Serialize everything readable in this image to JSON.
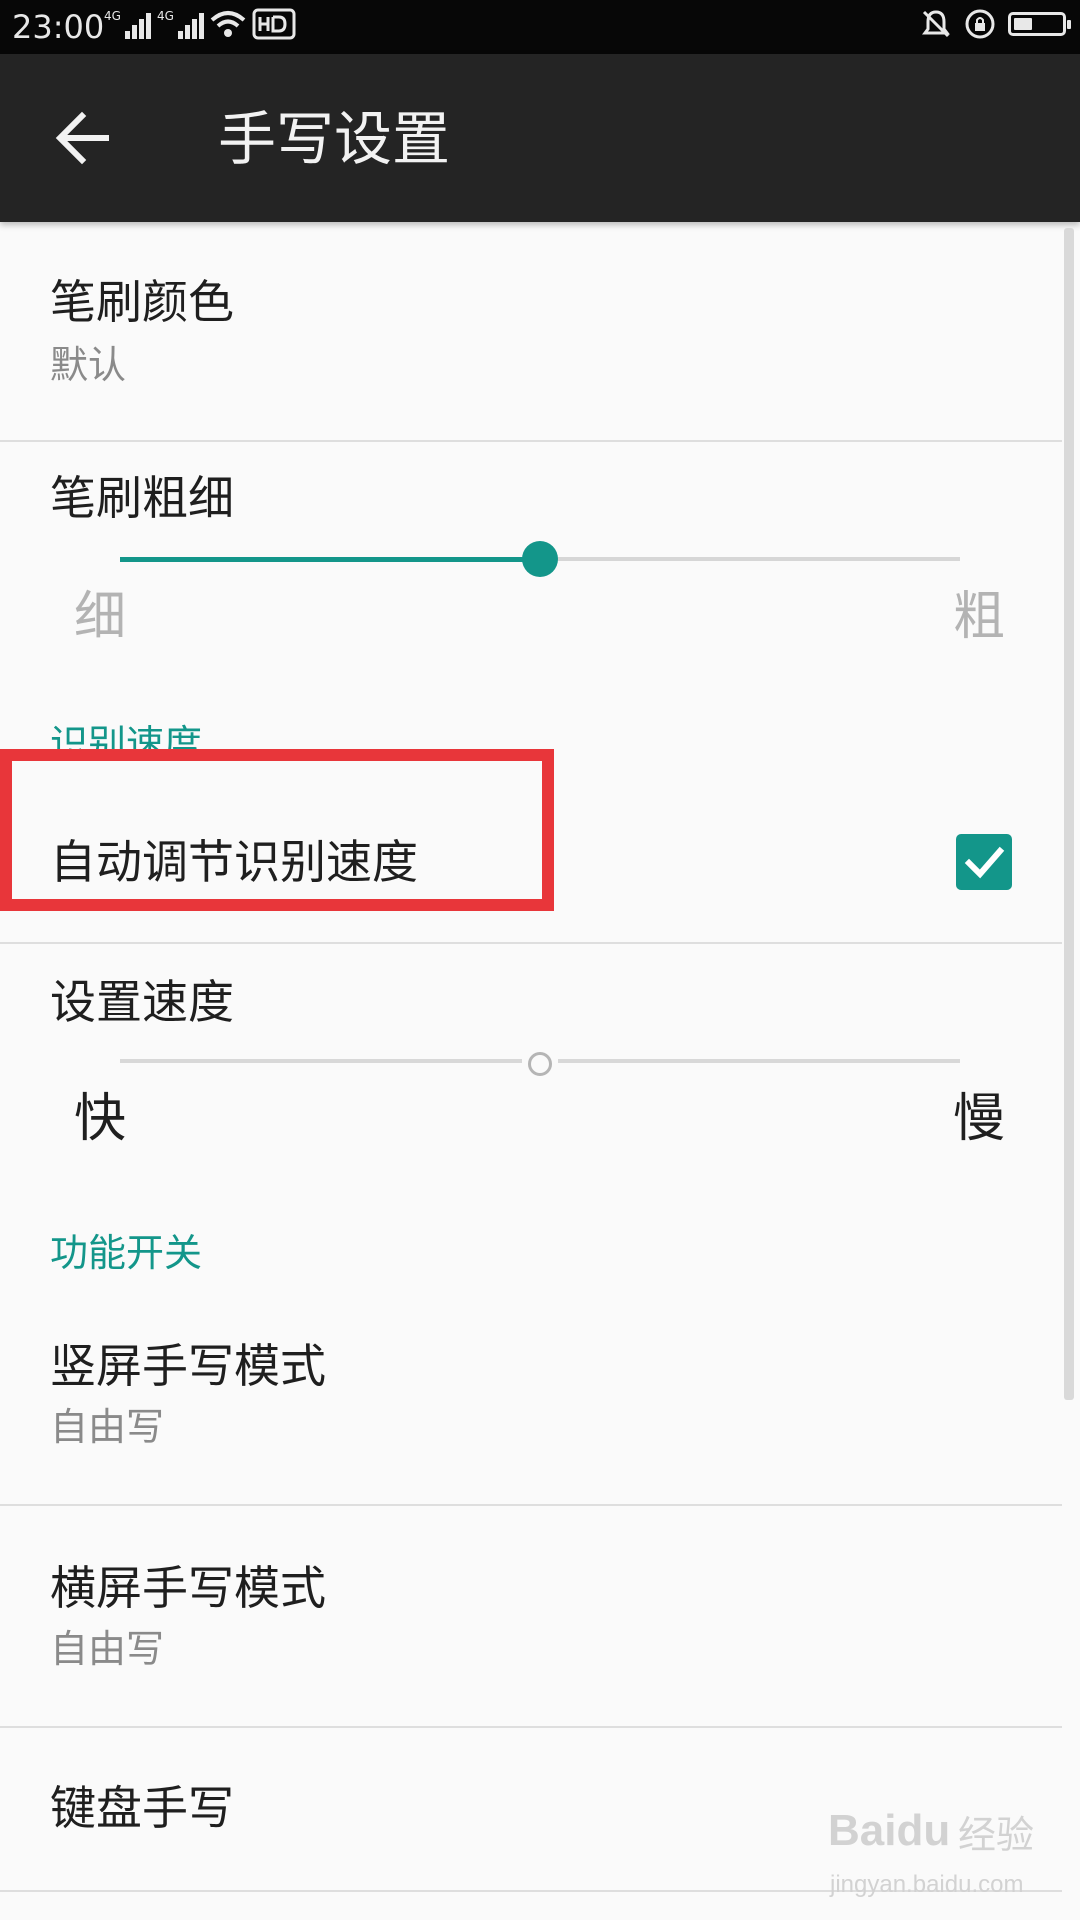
{
  "status_bar": {
    "time": "23:00",
    "network_1": "4G",
    "network_2": "4G",
    "icons": [
      "signal-icon",
      "signal-icon",
      "wifi-icon",
      "hd-icon",
      "bell-mute-icon",
      "rotation-lock-icon",
      "battery-icon"
    ],
    "battery_level": 0.4
  },
  "app_bar": {
    "title": "手写设置",
    "back_icon": "arrow-left-icon"
  },
  "brush_color": {
    "title": "笔刷颜色",
    "summary": "默认"
  },
  "brush_size": {
    "title": "笔刷粗细",
    "min_label": "细",
    "max_label": "粗",
    "value": 0.5
  },
  "recognition": {
    "header": "识别速度",
    "auto_adjust_label": "自动调节识别速度",
    "auto_adjust_checked": true
  },
  "speed": {
    "title": "设置速度",
    "min_label": "快",
    "max_label": "慢",
    "value": 0.5,
    "enabled": false
  },
  "features": {
    "header": "功能开关",
    "portrait_mode": {
      "title": "竖屏手写模式",
      "summary": "自由写"
    },
    "landscape_mode": {
      "title": "横屏手写模式",
      "summary": "自由写"
    },
    "keyboard_handwriting": {
      "title": "键盘手写"
    }
  },
  "watermark": {
    "logo": "Baidu",
    "text": "经验",
    "url": "jingyan.baidu.com"
  },
  "colors": {
    "accent": "#13968a",
    "highlight": "#e8363a",
    "app_bar": "#242424",
    "status_bar": "#070707"
  }
}
